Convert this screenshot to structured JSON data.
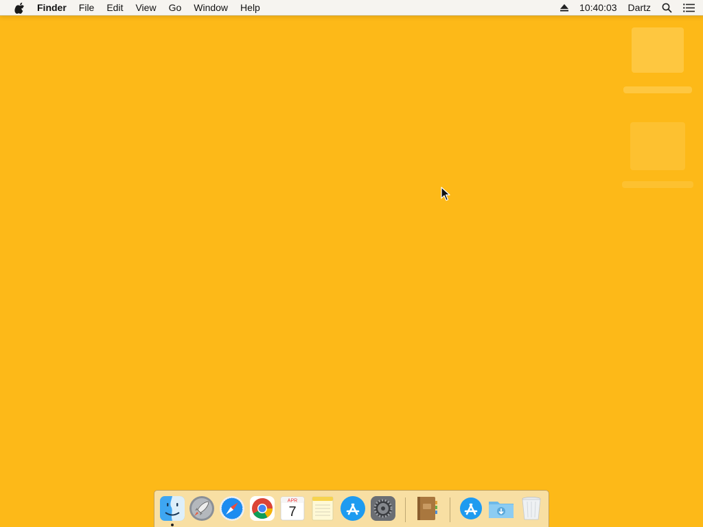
{
  "menubar": {
    "app_name": "Finder",
    "menus": [
      "File",
      "Edit",
      "View",
      "Go",
      "Window",
      "Help"
    ],
    "clock": "10:40:03",
    "user": "Dartz"
  },
  "desktop": {
    "wallpaper_color": "#FDB918"
  },
  "dock": {
    "apps": [
      {
        "name": "Finder",
        "icon": "finder-icon",
        "running": true
      },
      {
        "name": "Launchpad",
        "icon": "launchpad-icon",
        "running": false
      },
      {
        "name": "Safari",
        "icon": "safari-icon",
        "running": false
      },
      {
        "name": "Google Chrome",
        "icon": "chrome-icon",
        "running": false
      },
      {
        "name": "Calendar",
        "icon": "calendar-icon",
        "running": false,
        "month": "APR",
        "day": "7"
      },
      {
        "name": "Notes",
        "icon": "notes-icon",
        "running": false
      },
      {
        "name": "App Store",
        "icon": "app-store-icon",
        "running": false
      },
      {
        "name": "System Preferences",
        "icon": "system-preferences-icon",
        "running": false
      },
      {
        "name": "Notebook",
        "icon": "notebook-icon",
        "running": false
      }
    ],
    "stacks": [
      {
        "name": "Applications",
        "icon": "applications-stack-icon"
      },
      {
        "name": "Downloads",
        "icon": "downloads-folder-icon"
      },
      {
        "name": "Trash",
        "icon": "trash-icon"
      }
    ]
  }
}
